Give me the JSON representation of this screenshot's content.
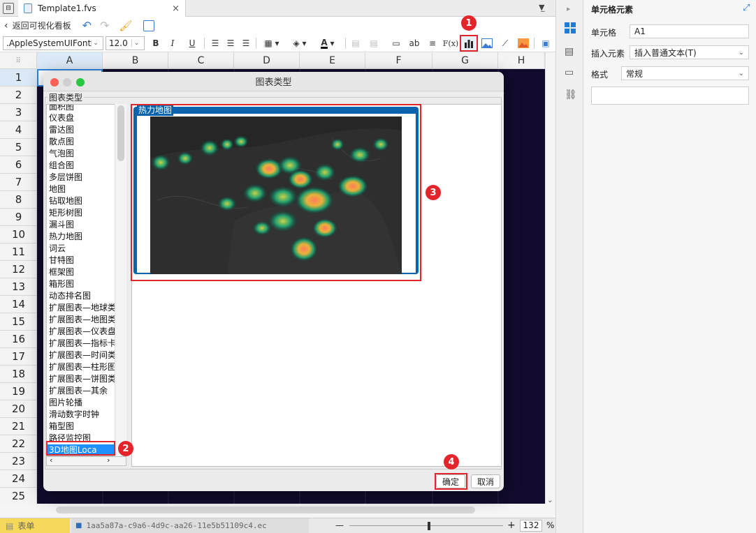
{
  "tabbar": {
    "file_tab": "Template1.fvs"
  },
  "toolbar": {
    "back_label": "返回可视化看板"
  },
  "format": {
    "font": ".AppleSystemUIFont",
    "size": "12.0",
    "bold": "B",
    "italic": "I",
    "underline": "U",
    "ab": "ab",
    "fx": "F(x)"
  },
  "columns": [
    "A",
    "B",
    "C",
    "D",
    "E",
    "F",
    "G",
    "H"
  ],
  "rows": [
    "1",
    "2",
    "3",
    "4",
    "5",
    "6",
    "7",
    "8",
    "9",
    "10",
    "11",
    "12",
    "13",
    "14",
    "15",
    "16",
    "17",
    "18",
    "19",
    "20",
    "21",
    "22",
    "23",
    "24",
    "25"
  ],
  "dialog": {
    "title": "图表类型",
    "group_label": "图表类型",
    "chart_types": [
      "面积图",
      "仪表盘",
      "雷达图",
      "散点图",
      "气泡图",
      "组合图",
      "多层饼图",
      "地图",
      "钻取地图",
      "矩形树图",
      "漏斗图",
      "热力地图",
      "词云",
      "甘特图",
      "框架图",
      "箱形图",
      "动态排名图",
      "扩展图表—地球类",
      "扩展图表—地图类",
      "扩展图表—仪表盘",
      "扩展图表—指标卡",
      "扩展图表—时间类",
      "扩展图表—柱形图",
      "扩展图表—饼图类",
      "扩展图表—其余",
      "图片轮播",
      "滑动数字时钟",
      "箱型图",
      "路径监控图",
      "3D地图Loca"
    ],
    "selected_index": 29,
    "preview_label": "热力地图",
    "ok": "确定",
    "cancel": "取消"
  },
  "status": {
    "sheet": "表单",
    "id": "1aa5a87a-c9a6-4d9c-aa26-11e5b51109c4.ec",
    "zoom": "132",
    "percent": "%",
    "minus": "—",
    "plus": "+"
  },
  "panel": {
    "title": "单元格元素",
    "cell_label": "单元格",
    "cell_value": "A1",
    "insert_label": "插入元素",
    "insert_value": "插入普通文本(T)",
    "format_label": "格式",
    "format_value": "常规"
  },
  "badges": [
    "1",
    "2",
    "3",
    "4"
  ],
  "colors": {
    "accent": "#0a64ad",
    "highlight": "#e0262c",
    "grid_bg": "#120b2e",
    "selected_bg": "#1e90ff"
  }
}
